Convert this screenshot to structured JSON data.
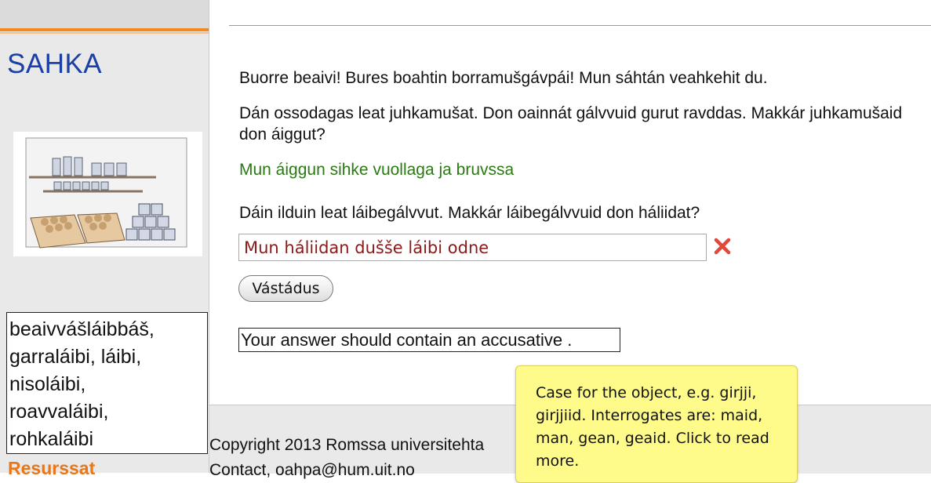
{
  "app": {
    "title": "SAHKA"
  },
  "sidebar": {
    "word_list": [
      "beaivvášláibbáš,",
      "garraláibi, láibi,",
      "nisoláibi,",
      "roavvaláibi,",
      "rohkaláibi"
    ],
    "resources_label": "Resurssat"
  },
  "main": {
    "greeting": "Buorre beaivi! Bures boahtin borramušgávpái! Mun sáhtán veahkehit du.",
    "question_1": "Dán ossodagas leat juhkamušat. Don oainnát gálvvuid gurut ravddas. Makkár juhkamušaid don áiggut?",
    "answer_1": "Mun áiggun sihke vuollaga ja bruvssa",
    "question_2": "Dáin ilduin leat láibegálvvut. Makkár láibegálvvuid don háliidat?",
    "answer_input": {
      "value": "Mun háliidan dušše láibi odne",
      "status": "wrong"
    },
    "submit_label": "Vástádus",
    "feedback": "Your answer should contain an accusative ."
  },
  "footer": {
    "copyright": "Copyright 2013 Romssa universitehta",
    "contact": "Contact, oahpa@hum.uit.no"
  },
  "tooltip": {
    "lines": [
      "Case for the object, e.g. girjji,",
      "girjjiid. Interrogates are: maid,",
      "man, gean, geaid. Click to read",
      "more."
    ]
  },
  "colors": {
    "brand_title": "#1a3fa6",
    "accent_orange": "#f08a1e",
    "correct_green": "#2a7a12",
    "wrong_red": "#8a1a1a",
    "tooltip_yellow": "#fefb8a"
  },
  "icons": {
    "wrong": "close-x-icon"
  }
}
